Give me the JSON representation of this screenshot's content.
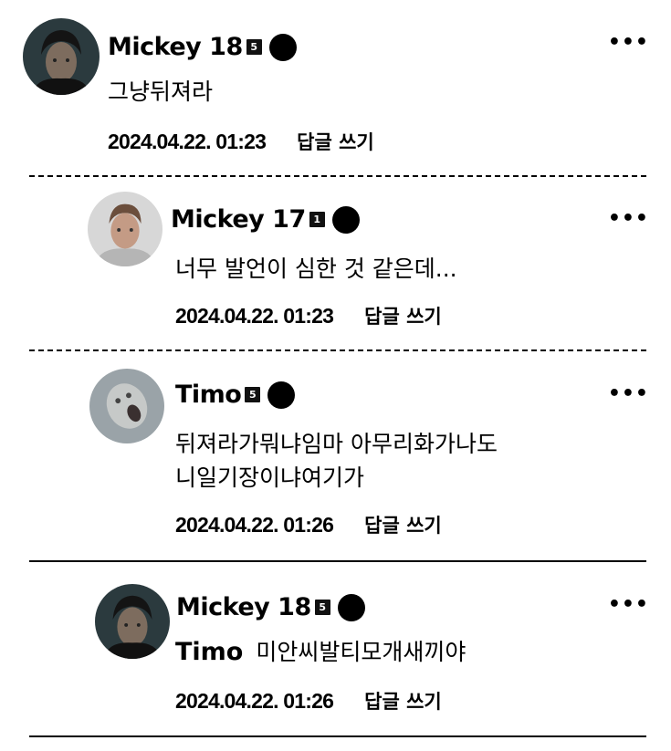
{
  "comments": [
    {
      "author": "Mickey 18",
      "level": "5",
      "text": "그냥뒤져라",
      "mention": "",
      "date": "2024.04.22. 01:23",
      "reply_label": "답글 쓰기",
      "more_label": "•••",
      "avatar_icon": "avatar-dark-portrait"
    },
    {
      "author": "Mickey 17",
      "level": "1",
      "text": "너무 발언이 심한 것 같은데...",
      "mention": "",
      "date": "2024.04.22. 01:23",
      "reply_label": "답글 쓰기",
      "more_label": "•••",
      "avatar_icon": "avatar-light-portrait"
    },
    {
      "author": "Timo",
      "level": "5",
      "text_lines": [
        "뒤져라가뭐냐임마 아무리화가나도",
        "니일기장이냐여기가"
      ],
      "mention": "",
      "date": "2024.04.22. 01:26",
      "reply_label": "답글 쓰기",
      "more_label": "•••",
      "avatar_icon": "avatar-screaming-face"
    },
    {
      "author": "Mickey 18",
      "level": "5",
      "text": "미안씨발티모개새끼야",
      "mention": "Timo",
      "date": "2024.04.22. 01:26",
      "reply_label": "답글 쓰기",
      "more_label": "•••",
      "avatar_icon": "avatar-dark-portrait"
    }
  ]
}
